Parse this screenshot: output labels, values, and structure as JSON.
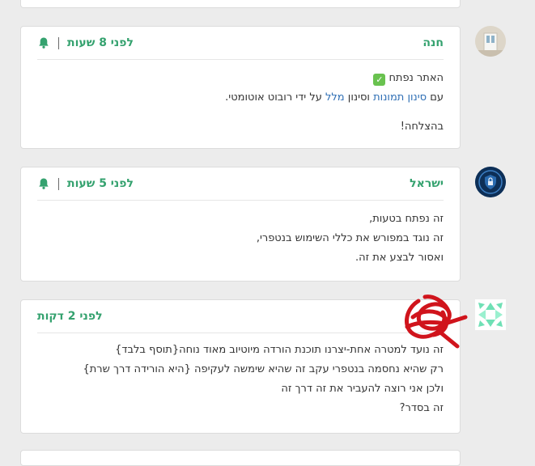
{
  "comments": [
    {
      "author": "חנה",
      "time": "לפני 8 שעות",
      "avatar_icon": "user-photo-avatar",
      "line1_text": "האתר נפתח",
      "line2_pre": "עם",
      "line2_link1": "סינון תמונות",
      "line2_mid": "וסינון",
      "line2_link2": "מלל",
      "line2_post": "על ידי רובוט אוטומטי.",
      "line3": "בהצלחה!"
    },
    {
      "author": "ישראל",
      "time": "לפני 5 שעות",
      "avatar_icon": "shield-lock-avatar",
      "lines": [
        "זה נפתח בטעות,",
        "זה נוגד במפורש את כללי השימוש בנטפרי,",
        "ואסור לבצע את זה."
      ]
    },
    {
      "time": "לפני 2 דקות",
      "avatar_icon": "geometric-pattern-avatar",
      "lines": [
        "זה נועד למטרה אחת-יצרנו תוכנת הורדה מיוטיוב מאוד נוחה{תוסף בלבד}",
        "רק שהיא נחסמה בנטפרי עקב זה שהיא שימשה לעקיפה {היא הורידה דרך שרת}",
        "ולכן אני רוצה להעביר את זה דרך זה",
        "זה בסדר?"
      ]
    }
  ],
  "colors": {
    "accent": "#35a26f",
    "background": "#ececec",
    "redacted": "#d0141c"
  },
  "icons": {
    "bell": "bell-icon",
    "check": "check-mark-icon"
  }
}
